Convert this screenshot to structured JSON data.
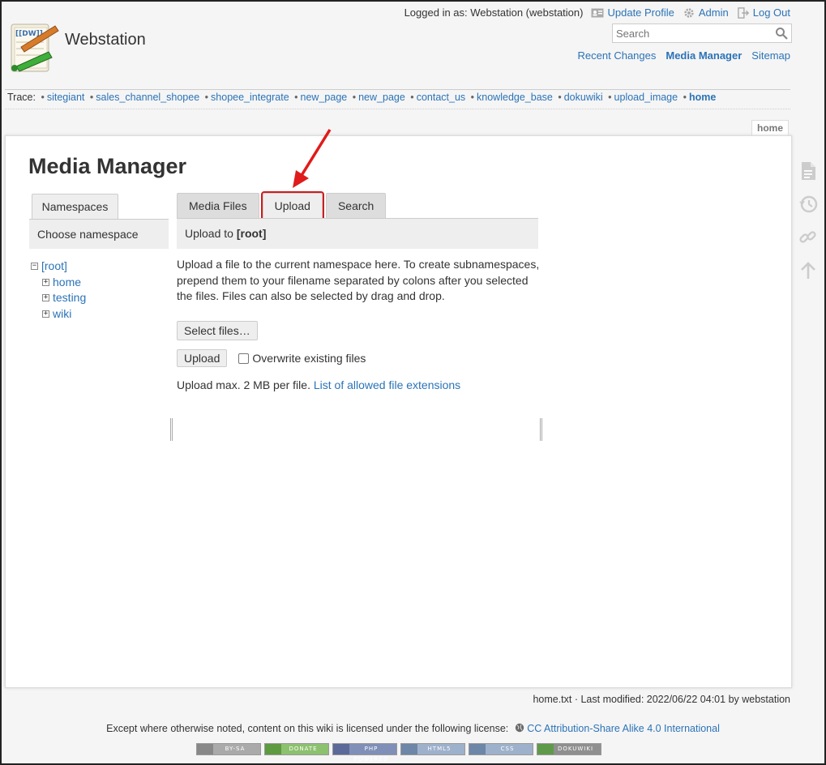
{
  "header": {
    "site_title": "Webstation",
    "logged_in": "Logged in as: Webstation (webstation)",
    "user_tools": [
      "Update Profile",
      "Admin",
      "Log Out"
    ],
    "search_placeholder": "Search",
    "site_tools": [
      "Recent Changes",
      "Media Manager",
      "Sitemap"
    ],
    "logo_text": "[[DW]]"
  },
  "trace": {
    "label": "Trace:",
    "items": [
      "sitegiant",
      "sales_channel_shopee",
      "shopee_integrate",
      "new_page",
      "new_page",
      "contact_us",
      "knowledge_base",
      "dokuwiki",
      "upload_image",
      "home"
    ]
  },
  "page_tab": "home",
  "main": {
    "title": "Media Manager",
    "namespaces": {
      "tab": "Namespaces",
      "heading": "Choose namespace",
      "root": "[root]",
      "children": [
        "home",
        "testing",
        "wiki"
      ]
    },
    "tabs": [
      "Media Files",
      "Upload",
      "Search"
    ],
    "panel_heading_prefix": "Upload to ",
    "panel_heading_ns": "[root]",
    "upload_desc": "Upload a file to the current namespace here. To create subnamespaces, prepend them to your filename separated by colons after you selected the files. Files can also be selected by drag and drop.",
    "select_files": "Select files…",
    "upload_button": "Upload",
    "overwrite_label": "Overwrite existing files",
    "upload_max": "Upload max. 2 MB per file.",
    "allowed_ext_link": "List of allowed file extensions"
  },
  "footer": {
    "docinfo": "home.txt · Last modified: 2022/06/22 04:01 by webstation",
    "license_text": "Except where otherwise noted, content on this wiki is licensed under the following license:",
    "license_link": "CC Attribution-Share Alike 4.0 International",
    "badges": [
      "BY-SA",
      "DONATE",
      "PHP POWERED",
      "HTML5",
      "CSS",
      "DOKUWIKI"
    ]
  },
  "colors": {
    "link": "#2b73b7",
    "highlight": "#d01c1c"
  }
}
